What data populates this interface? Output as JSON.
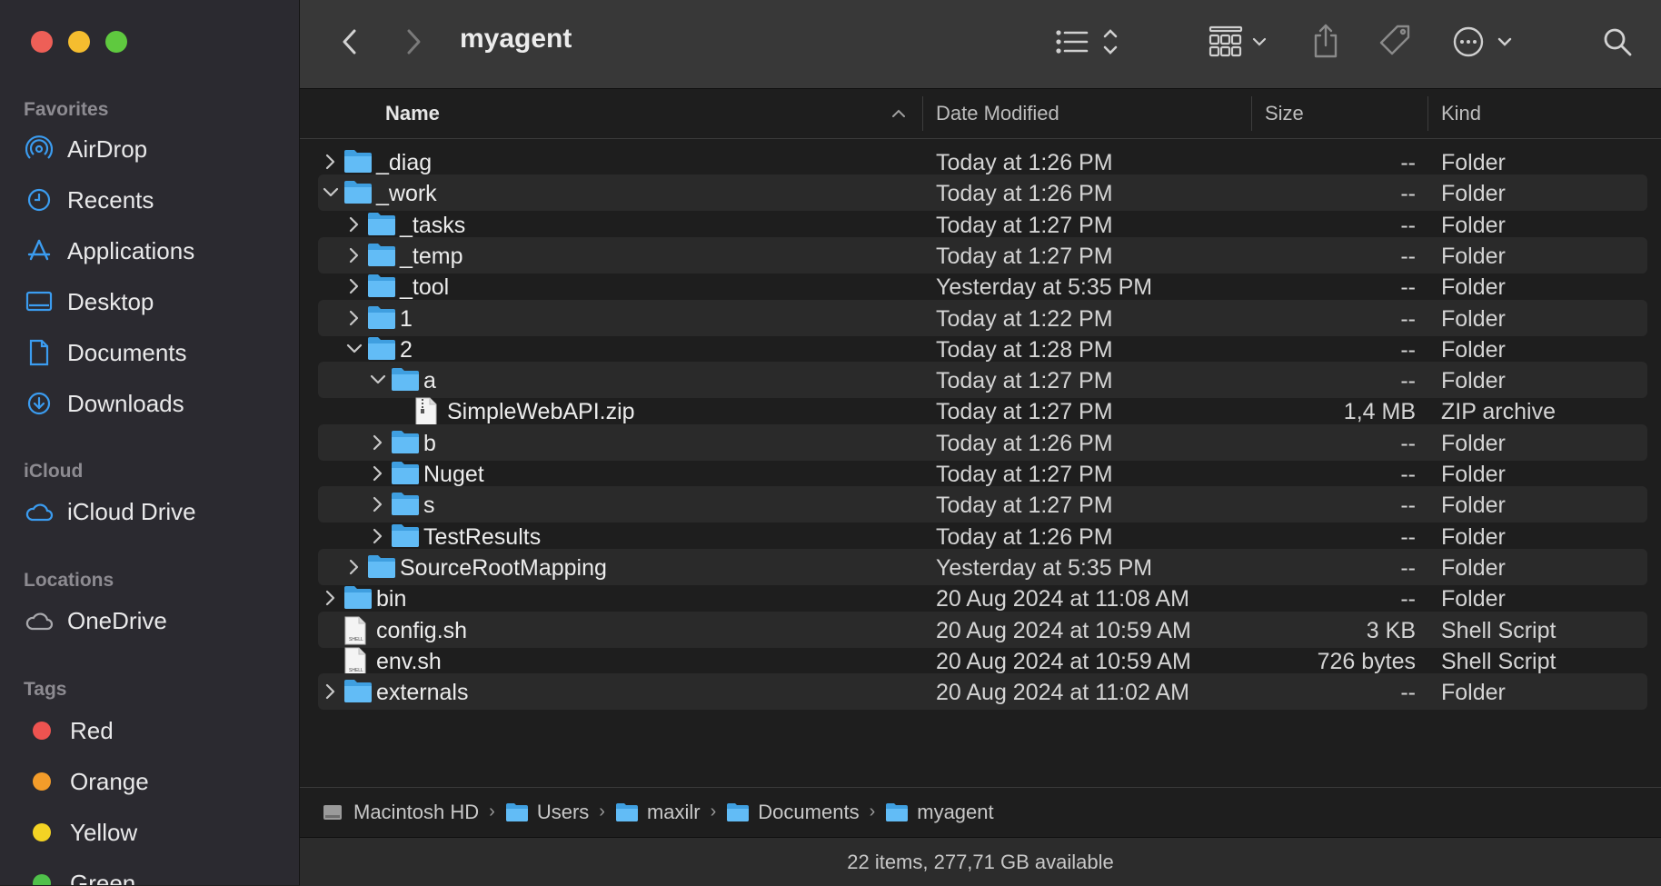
{
  "sidebar": {
    "favorites_title": "Favorites",
    "favorites": [
      {
        "label": "AirDrop",
        "icon": "airdrop-icon"
      },
      {
        "label": "Recents",
        "icon": "clock-icon"
      },
      {
        "label": "Applications",
        "icon": "applications-icon"
      },
      {
        "label": "Desktop",
        "icon": "desktop-icon"
      },
      {
        "label": "Documents",
        "icon": "document-icon"
      },
      {
        "label": "Downloads",
        "icon": "download-icon"
      }
    ],
    "icloud_title": "iCloud",
    "icloud": [
      {
        "label": "iCloud Drive",
        "icon": "cloud-icon"
      }
    ],
    "locations_title": "Locations",
    "locations": [
      {
        "label": "OneDrive",
        "icon": "cloud-outline-icon"
      }
    ],
    "tags_title": "Tags",
    "tags": [
      {
        "label": "Red",
        "color": "#ee5350"
      },
      {
        "label": "Orange",
        "color": "#f39c2a"
      },
      {
        "label": "Yellow",
        "color": "#f4d324"
      },
      {
        "label": "Green",
        "color": "#4fc04a"
      }
    ]
  },
  "toolbar": {
    "title": "myagent",
    "back_icon": "chevron-left-icon",
    "forward_icon": "chevron-right-icon",
    "list_view_icon": "list-view-icon",
    "grid_view_icon": "grid-view-icon",
    "share_icon": "share-icon",
    "tag_icon": "tag-icon",
    "more_icon": "ellipsis-circle-icon",
    "search_icon": "search-icon"
  },
  "columns": {
    "name": "Name",
    "date": "Date Modified",
    "size": "Size",
    "kind": "Kind"
  },
  "files": [
    {
      "name": "_diag",
      "date": "Today at 1:26 PM",
      "size": "--",
      "kind": "Folder",
      "type": "folder",
      "level": 0,
      "expanded": false
    },
    {
      "name": "_work",
      "date": "Today at 1:26 PM",
      "size": "--",
      "kind": "Folder",
      "type": "folder",
      "level": 0,
      "expanded": true
    },
    {
      "name": "_tasks",
      "date": "Today at 1:27 PM",
      "size": "--",
      "kind": "Folder",
      "type": "folder",
      "level": 1,
      "expanded": false
    },
    {
      "name": "_temp",
      "date": "Today at 1:27 PM",
      "size": "--",
      "kind": "Folder",
      "type": "folder",
      "level": 1,
      "expanded": false
    },
    {
      "name": "_tool",
      "date": "Yesterday at 5:35 PM",
      "size": "--",
      "kind": "Folder",
      "type": "folder",
      "level": 1,
      "expanded": false
    },
    {
      "name": "1",
      "date": "Today at 1:22 PM",
      "size": "--",
      "kind": "Folder",
      "type": "folder",
      "level": 1,
      "expanded": false
    },
    {
      "name": "2",
      "date": "Today at 1:28 PM",
      "size": "--",
      "kind": "Folder",
      "type": "folder",
      "level": 1,
      "expanded": true
    },
    {
      "name": "a",
      "date": "Today at 1:27 PM",
      "size": "--",
      "kind": "Folder",
      "type": "folder",
      "level": 2,
      "expanded": true
    },
    {
      "name": "SimpleWebAPI.zip",
      "date": "Today at 1:27 PM",
      "size": "1,4 MB",
      "kind": "ZIP archive",
      "type": "zip",
      "level": 3
    },
    {
      "name": "b",
      "date": "Today at 1:26 PM",
      "size": "--",
      "kind": "Folder",
      "type": "folder",
      "level": 2,
      "expanded": false
    },
    {
      "name": "Nuget",
      "date": "Today at 1:27 PM",
      "size": "--",
      "kind": "Folder",
      "type": "folder",
      "level": 2,
      "expanded": false
    },
    {
      "name": "s",
      "date": "Today at 1:27 PM",
      "size": "--",
      "kind": "Folder",
      "type": "folder",
      "level": 2,
      "expanded": false
    },
    {
      "name": "TestResults",
      "date": "Today at 1:26 PM",
      "size": "--",
      "kind": "Folder",
      "type": "folder",
      "level": 2,
      "expanded": false
    },
    {
      "name": "SourceRootMapping",
      "date": "Yesterday at 5:35 PM",
      "size": "--",
      "kind": "Folder",
      "type": "folder",
      "level": 1,
      "expanded": false
    },
    {
      "name": "bin",
      "date": "20 Aug 2024 at 11:08 AM",
      "size": "--",
      "kind": "Folder",
      "type": "folder",
      "level": 0,
      "expanded": false
    },
    {
      "name": "config.sh",
      "date": "20 Aug 2024 at 10:59 AM",
      "size": "3 KB",
      "kind": "Shell Script",
      "type": "script",
      "level": 0
    },
    {
      "name": "env.sh",
      "date": "20 Aug 2024 at 10:59 AM",
      "size": "726 bytes",
      "kind": "Shell Script",
      "type": "script",
      "level": 0
    },
    {
      "name": "externals",
      "date": "20 Aug 2024 at 11:02 AM",
      "size": "--",
      "kind": "Folder",
      "type": "folder",
      "level": 0,
      "expanded": false
    }
  ],
  "pathbar": [
    {
      "label": "Macintosh HD",
      "icon": "hard-drive-icon"
    },
    {
      "label": "Users",
      "icon": "users-folder-icon"
    },
    {
      "label": "maxilr",
      "icon": "home-folder-icon"
    },
    {
      "label": "Documents",
      "icon": "documents-folder-icon"
    },
    {
      "label": "myagent",
      "icon": "folder-icon"
    }
  ],
  "status": "22 items, 277,71 GB available",
  "colors": {
    "folder": "#5ab8f5",
    "accent": "#3b9cf0"
  }
}
